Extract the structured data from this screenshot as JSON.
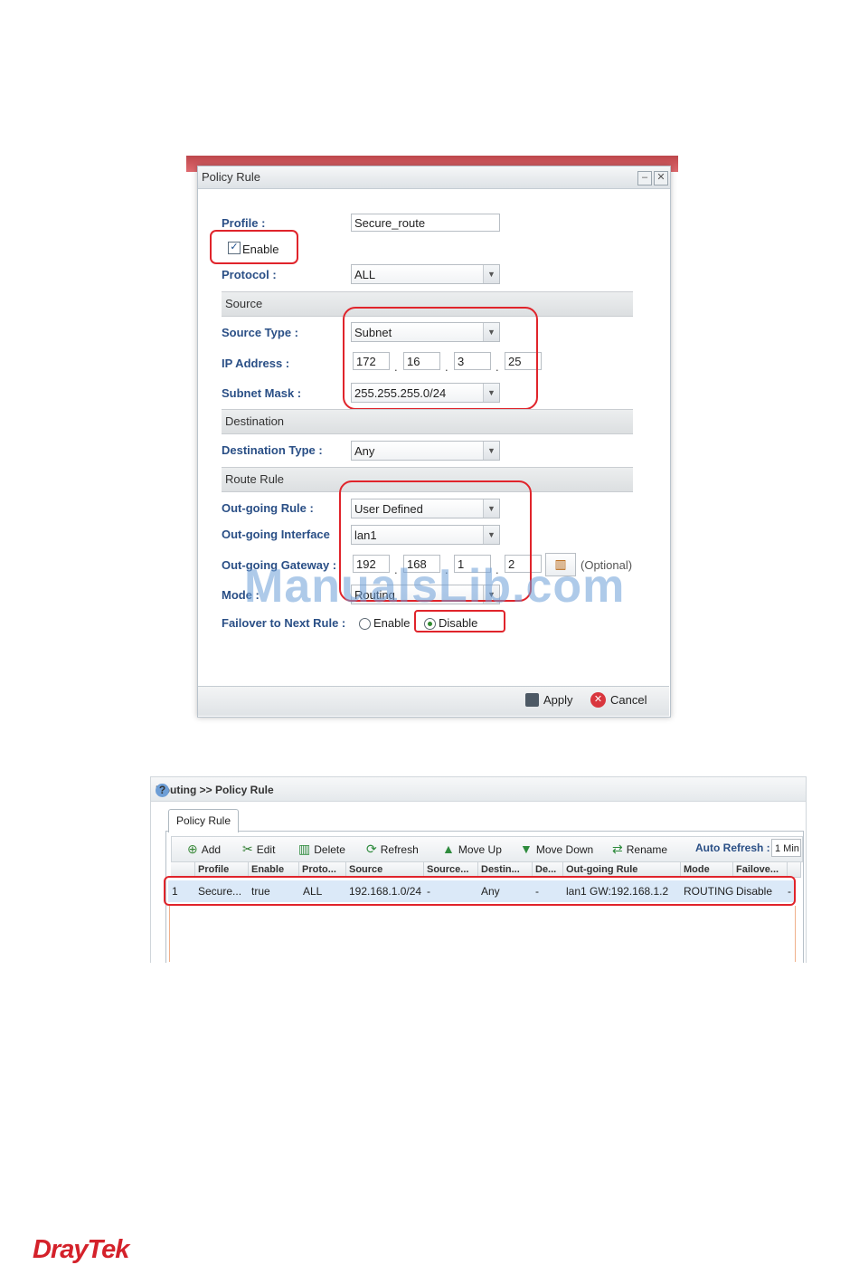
{
  "dialog": {
    "title": "Policy Rule",
    "profile_label": "Profile :",
    "profile_value": "Secure_route",
    "enable_label": "Enable",
    "protocol_label": "Protocol :",
    "protocol_value": "ALL",
    "source_section": "Source",
    "source_type_label": "Source Type :",
    "source_type_value": "Subnet",
    "ip_label": "IP Address :",
    "ip": [
      "172",
      "16",
      "3",
      "25"
    ],
    "mask_label": "Subnet Mask :",
    "mask_value": "255.255.255.0/24",
    "destination_section": "Destination",
    "dest_type_label": "Destination Type :",
    "dest_type_value": "Any",
    "route_section": "Route Rule",
    "outgoing_rule_label": "Out-going Rule :",
    "outgoing_rule_value": "User Defined",
    "outgoing_iface_label": "Out-going Interface",
    "outgoing_iface_value": "lan1",
    "gateway_label": "Out-going Gateway :",
    "gateway": [
      "192",
      "168",
      "1",
      "2"
    ],
    "optional": "(Optional)",
    "mode_label": "Mode :",
    "mode_value": "Routing",
    "failover_label": "Failover to Next Rule :",
    "failover_enable": "Enable",
    "failover_disable": "Disable",
    "apply": "Apply",
    "cancel": "Cancel"
  },
  "watermark": "ManualsLib.com",
  "list": {
    "breadcrumb": "Routing >> Policy Rule",
    "tab": "Policy Rule",
    "toolbar": {
      "add": "Add",
      "edit": "Edit",
      "delete": "Delete",
      "refresh": "Refresh",
      "move_up": "Move Up",
      "move_down": "Move Down",
      "rename": "Rename",
      "auto_refresh": "Auto Refresh :",
      "auto_refresh_value": "1 Min"
    },
    "columns": [
      "Profile",
      "Enable",
      "Proto...",
      "Source",
      "Source...",
      "Destin...",
      "De...",
      "Out-going Rule",
      "Mode",
      "Failove..."
    ],
    "row": [
      "1",
      "Secure...",
      "true",
      "ALL",
      "192.168.1.0/24",
      "-",
      "Any",
      "-",
      "lan1 GW:192.168.1.2",
      "ROUTING",
      "Disable",
      "-"
    ]
  },
  "logo": "DrayTek"
}
